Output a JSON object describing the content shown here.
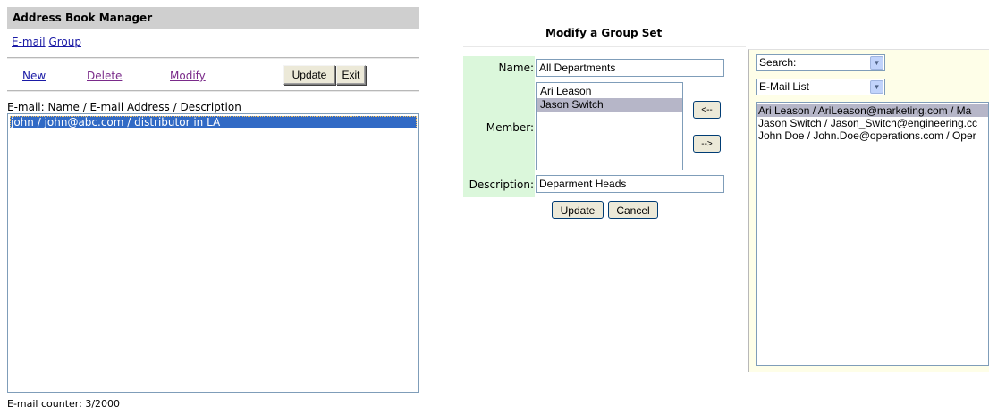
{
  "app": {
    "title": "Address Book Manager",
    "nav": {
      "email_link": "E-mail",
      "group_link": "Group"
    },
    "actions": {
      "new": "New",
      "delete": "Delete",
      "modify": "Modify",
      "update": "Update",
      "exit": "Exit"
    },
    "list_label": "E-mail: Name / E-mail Address / Description",
    "email_rows": [
      "john / john@abc.com / distributor in LA"
    ],
    "counter": "E-mail counter: 3/2000"
  },
  "modify_group": {
    "title": "Modify a Group Set",
    "name_label": "Name:",
    "name_value": "All Departments",
    "member_label": "Member:",
    "members": [
      "Ari Leason",
      "Jason Switch"
    ],
    "selected_member": "Jason Switch",
    "move_left": "<--",
    "move_right": "-->",
    "description_label": "Description:",
    "description_value": "Deparment Heads",
    "update": "Update",
    "cancel": "Cancel"
  },
  "contacts": {
    "search_select": "Search:",
    "list_select": "E-Mail List",
    "items": [
      "Ari Leason / AriLeason@marketing.com / Ma",
      "Jason Switch / Jason_Switch@engineering.cc",
      "John Doe / John.Doe@operations.com / Oper"
    ],
    "selected_item": "Ari Leason / AriLeason@marketing.com / Ma"
  },
  "colors": {
    "title_bar": "#cfcfcf",
    "selection_blue": "#316ac5",
    "selection_gray": "#b6b6c8",
    "form_side": "#dbf7db",
    "right_panel": "#fefee8"
  }
}
